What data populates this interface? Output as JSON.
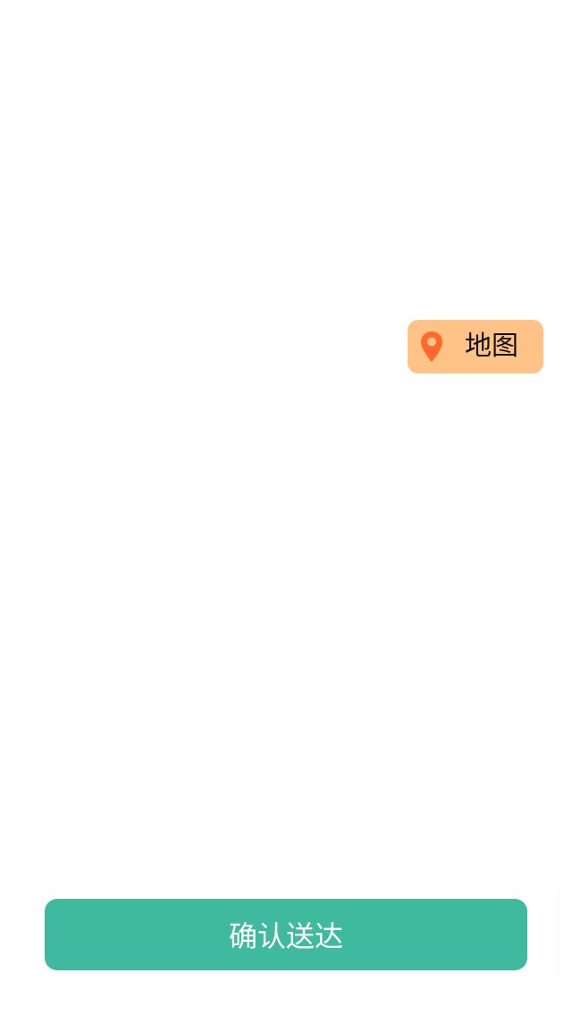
{
  "map_button": {
    "icon": "location-pin-icon",
    "label": "地图",
    "background_color": "#ffc388",
    "icon_color": "#ff6a2c"
  },
  "confirm_button": {
    "label": "确认送达",
    "background_color": "#3fba9f"
  }
}
